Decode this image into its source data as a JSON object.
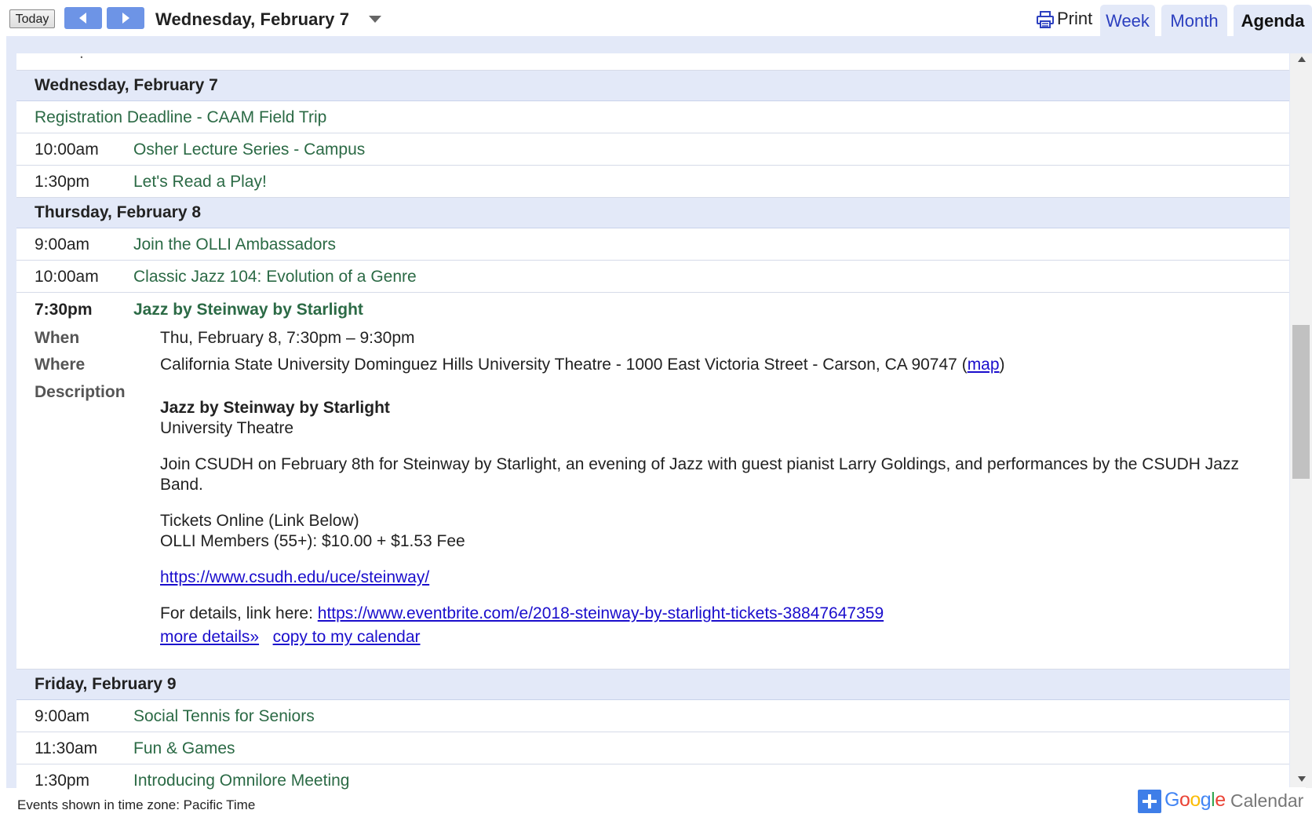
{
  "toolbar": {
    "today_label": "Today",
    "date_title": "Wednesday, February 7",
    "print_label": "Print",
    "tabs": {
      "week": "Week",
      "month": "Month",
      "agenda": "Agenda"
    },
    "active_tab": "Agenda"
  },
  "agenda": {
    "days": [
      {
        "date": "Wednesday, February 7",
        "events": [
          {
            "time": "",
            "title": "Registration Deadline - CAAM Field Trip"
          },
          {
            "time": "10:00am",
            "title": "Osher Lecture Series - Campus"
          },
          {
            "time": "1:30pm",
            "title": "Let's Read a Play!"
          }
        ]
      },
      {
        "date": "Thursday, February 8",
        "events": [
          {
            "time": "9:00am",
            "title": "Join the OLLI Ambassadors"
          },
          {
            "time": "10:00am",
            "title": "Classic Jazz 104: Evolution of a Genre"
          }
        ]
      },
      {
        "date": "Friday, February 9",
        "events": [
          {
            "time": "9:00am",
            "title": "Social Tennis for Seniors"
          },
          {
            "time": "11:30am",
            "title": "Fun & Games"
          },
          {
            "time": "1:30pm",
            "title": "Introducing Omnilore Meeting"
          }
        ]
      }
    ],
    "expanded_event": {
      "time": "7:30pm",
      "title": "Jazz by Steinway by Starlight",
      "when_label": "When",
      "when_value": "Thu, February 8, 7:30pm – 9:30pm",
      "where_label": "Where",
      "where_value": "California State University Dominguez Hills University Theatre - 1000 East Victoria Street - Carson, CA 90747",
      "map_open": "(",
      "map_link": "map",
      "map_close": ")",
      "description_label": "Description",
      "desc_title": "Jazz by Steinway by Starlight",
      "desc_venue": "University Theatre",
      "desc_body": "Join CSUDH on February 8th for Steinway by Starlight, an evening of Jazz with guest pianist Larry Goldings, and performances by the CSUDH Jazz Band.",
      "tickets_line": "Tickets Online (Link Below)",
      "price_line": "OLLI Members (55+): $10.00 + $1.53 Fee",
      "steinway_link": "https://www.csudh.edu/uce/steinway/",
      "details_prefix": "For details, link here: ",
      "eventbrite_link": "https://www.eventbrite.com/e/2018-steinway-by-starlight-tickets-38847647359",
      "more_details": "more details»",
      "copy_to_calendar": "copy to my calendar"
    }
  },
  "footer": {
    "timezone_text": "Events shown in time zone: Pacific Time",
    "gcal_google": "Google",
    "gcal_calendar": "Calendar"
  },
  "colors": {
    "event_title": "#2b6a45",
    "header_bg": "#e3e9f8",
    "nav_button": "#6d94e6",
    "link": "#1a0dcc"
  },
  "icons": [
    "chevron-left-icon",
    "chevron-right-icon",
    "caret-down-icon",
    "printer-icon",
    "scroll-up-icon",
    "scroll-down-icon",
    "google-calendar-plus-icon"
  ]
}
